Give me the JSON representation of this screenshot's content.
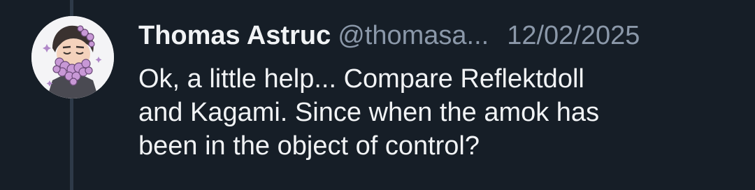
{
  "post": {
    "author": {
      "display_name": "Thomas Astruc",
      "handle": "@thomasa...",
      "avatar_icon": "bearded-man-with-flowers-avatar"
    },
    "timestamp": "12/02/2025",
    "text": "Ok, a little help... Compare Reflektdoll\nand Kagami. Since when the amok has\nbeen in the object of control?"
  },
  "colors": {
    "background": "#161e27",
    "thread_line": "#2e3a48",
    "primary_text": "#f1f3f5",
    "secondary_text": "#8b98a9"
  }
}
